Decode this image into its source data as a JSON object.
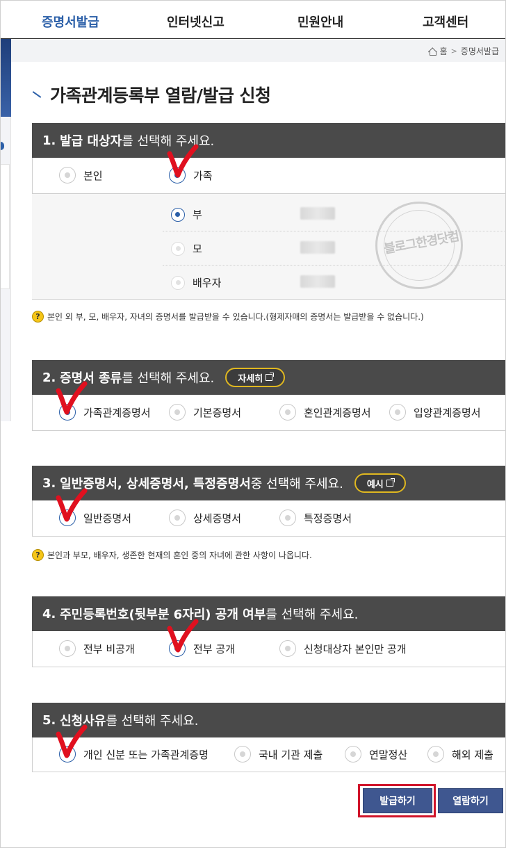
{
  "nav": {
    "items": [
      "증명서발급",
      "인터넷신고",
      "민원안내",
      "고객센터"
    ],
    "active": 0
  },
  "breadcrumb": {
    "home": "홈",
    "current": "증명서발급"
  },
  "page": {
    "title": "가족관계등록부 열람/발급 신청"
  },
  "section1": {
    "num": "1.",
    "title_bold": "발급 대상자",
    "title_rest": "를 선택해 주세요.",
    "options": [
      "본인",
      "가족"
    ],
    "selected": 1,
    "family": [
      "부",
      "모",
      "배우자"
    ],
    "family_selected": 0,
    "note": "본인 외 부, 모, 배우자, 자녀의 증명서를 발급받을 수 있습니다.(형제자매의 증명서는 발급받을 수 없습니다.)",
    "watermark": "블로그한경닷컴"
  },
  "section2": {
    "num": "2.",
    "title_bold": "증명서 종류",
    "title_rest": "를 선택해 주세요.",
    "detail_button": "자세히",
    "options": [
      "가족관계증명서",
      "기본증명서",
      "혼인관계증명서",
      "입양관계증명서"
    ],
    "selected": 0
  },
  "section3": {
    "num": "3.",
    "title_bold": "일반증명서, 상세증명서, 특정증명서",
    "title_rest": " 중 선택해 주세요.",
    "example_button": "예시",
    "options": [
      "일반증명서",
      "상세증명서",
      "특정증명서"
    ],
    "selected": 0,
    "note": "본인과 부모, 배우자, 생존한 현재의 혼인 중의 자녀에 관한 사항이 나옵니다."
  },
  "section4": {
    "num": "4.",
    "title_bold": "주민등록번호(뒷부분 6자리) 공개 여부",
    "title_rest": "를 선택해 주세요.",
    "options": [
      "전부 비공개",
      "전부 공개",
      "신청대상자 본인만 공개"
    ],
    "selected": 1
  },
  "section5": {
    "num": "5.",
    "title_bold": "신청사유",
    "title_rest": "를 선택해 주세요.",
    "options": [
      "개인 신분 또는 가족관계증명",
      "국내 기관 제출",
      "연말정산",
      "해외 제출"
    ],
    "selected": 0
  },
  "buttons": {
    "issue": "발급하기",
    "view": "열람하기"
  },
  "colors": {
    "accent": "#2b5fa8",
    "header_bg": "#4a4a4a",
    "button_bg": "#3f5790",
    "highlight": "#d0142a",
    "pill_border": "#e0b820",
    "check": "#e0101f"
  }
}
